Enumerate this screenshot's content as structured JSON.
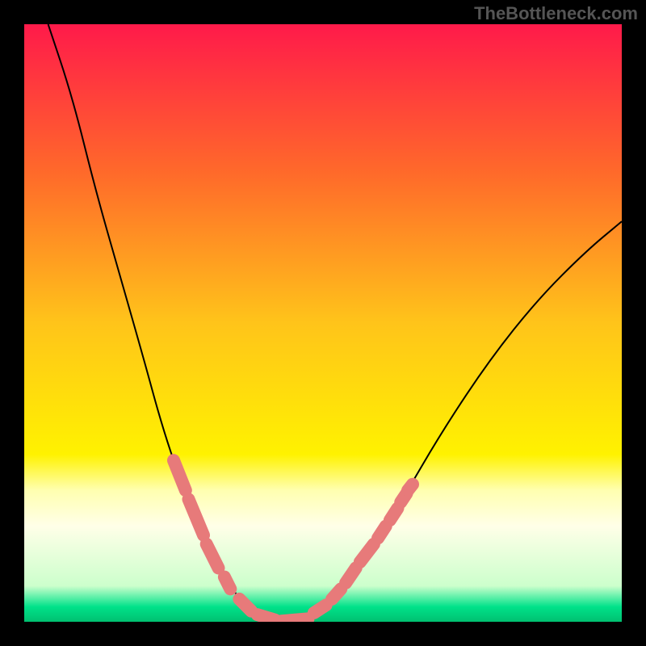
{
  "watermark": "TheBottleneck.com",
  "chart_data": {
    "type": "line",
    "title": "",
    "xlabel": "",
    "ylabel": "",
    "xlim": [
      0,
      100
    ],
    "ylim": [
      0,
      100
    ],
    "grid": false,
    "legend": false,
    "background_gradient": {
      "stops": [
        {
          "offset": 0.0,
          "color": "#ff1a4a"
        },
        {
          "offset": 0.25,
          "color": "#ff6a2a"
        },
        {
          "offset": 0.5,
          "color": "#ffc41a"
        },
        {
          "offset": 0.72,
          "color": "#fff200"
        },
        {
          "offset": 0.78,
          "color": "#ffffb0"
        },
        {
          "offset": 0.84,
          "color": "#ffffe8"
        },
        {
          "offset": 0.94,
          "color": "#ccffcc"
        },
        {
          "offset": 0.975,
          "color": "#00e28a"
        },
        {
          "offset": 1.0,
          "color": "#00c070"
        }
      ]
    },
    "series": [
      {
        "name": "bottleneck-curve",
        "style": "line",
        "color": "#000000",
        "points": [
          {
            "x": 4,
            "y": 100
          },
          {
            "x": 8,
            "y": 88
          },
          {
            "x": 12,
            "y": 72
          },
          {
            "x": 16,
            "y": 58
          },
          {
            "x": 20,
            "y": 44
          },
          {
            "x": 23,
            "y": 33
          },
          {
            "x": 26,
            "y": 24
          },
          {
            "x": 29,
            "y": 16
          },
          {
            "x": 32,
            "y": 10
          },
          {
            "x": 35,
            "y": 5
          },
          {
            "x": 38,
            "y": 2
          },
          {
            "x": 41,
            "y": 0.5
          },
          {
            "x": 44,
            "y": 0
          },
          {
            "x": 47,
            "y": 0.5
          },
          {
            "x": 50,
            "y": 2
          },
          {
            "x": 54,
            "y": 6
          },
          {
            "x": 58,
            "y": 12
          },
          {
            "x": 63,
            "y": 20
          },
          {
            "x": 70,
            "y": 32
          },
          {
            "x": 78,
            "y": 44
          },
          {
            "x": 86,
            "y": 54
          },
          {
            "x": 94,
            "y": 62
          },
          {
            "x": 100,
            "y": 67
          }
        ]
      },
      {
        "name": "highlight-capsules",
        "style": "capsule-markers",
        "color": "#e77a7a",
        "segments": [
          {
            "x1": 25,
            "y1": 27,
            "x2": 27,
            "y2": 22
          },
          {
            "x1": 27.5,
            "y1": 20.5,
            "x2": 30,
            "y2": 14.5
          },
          {
            "x1": 30.5,
            "y1": 13,
            "x2": 32.5,
            "y2": 9
          },
          {
            "x1": 33.5,
            "y1": 7.5,
            "x2": 34.5,
            "y2": 5.5
          },
          {
            "x1": 36,
            "y1": 3.8,
            "x2": 38,
            "y2": 1.8
          },
          {
            "x1": 39,
            "y1": 1.2,
            "x2": 42,
            "y2": 0.3
          },
          {
            "x1": 43,
            "y1": 0.1,
            "x2": 47.5,
            "y2": 0.5
          },
          {
            "x1": 48.5,
            "y1": 1.5,
            "x2": 50.5,
            "y2": 2.8
          },
          {
            "x1": 51.5,
            "y1": 3.8,
            "x2": 53,
            "y2": 5.5
          },
          {
            "x1": 53.8,
            "y1": 6.5,
            "x2": 55.5,
            "y2": 9
          },
          {
            "x1": 56.2,
            "y1": 10,
            "x2": 58.5,
            "y2": 13
          },
          {
            "x1": 59.2,
            "y1": 14,
            "x2": 60.5,
            "y2": 16
          },
          {
            "x1": 61.2,
            "y1": 17,
            "x2": 62.5,
            "y2": 19
          },
          {
            "x1": 63,
            "y1": 20,
            "x2": 64,
            "y2": 21.5
          },
          {
            "x1": 64.2,
            "y1": 22,
            "x2": 65,
            "y2": 23
          }
        ]
      }
    ]
  }
}
